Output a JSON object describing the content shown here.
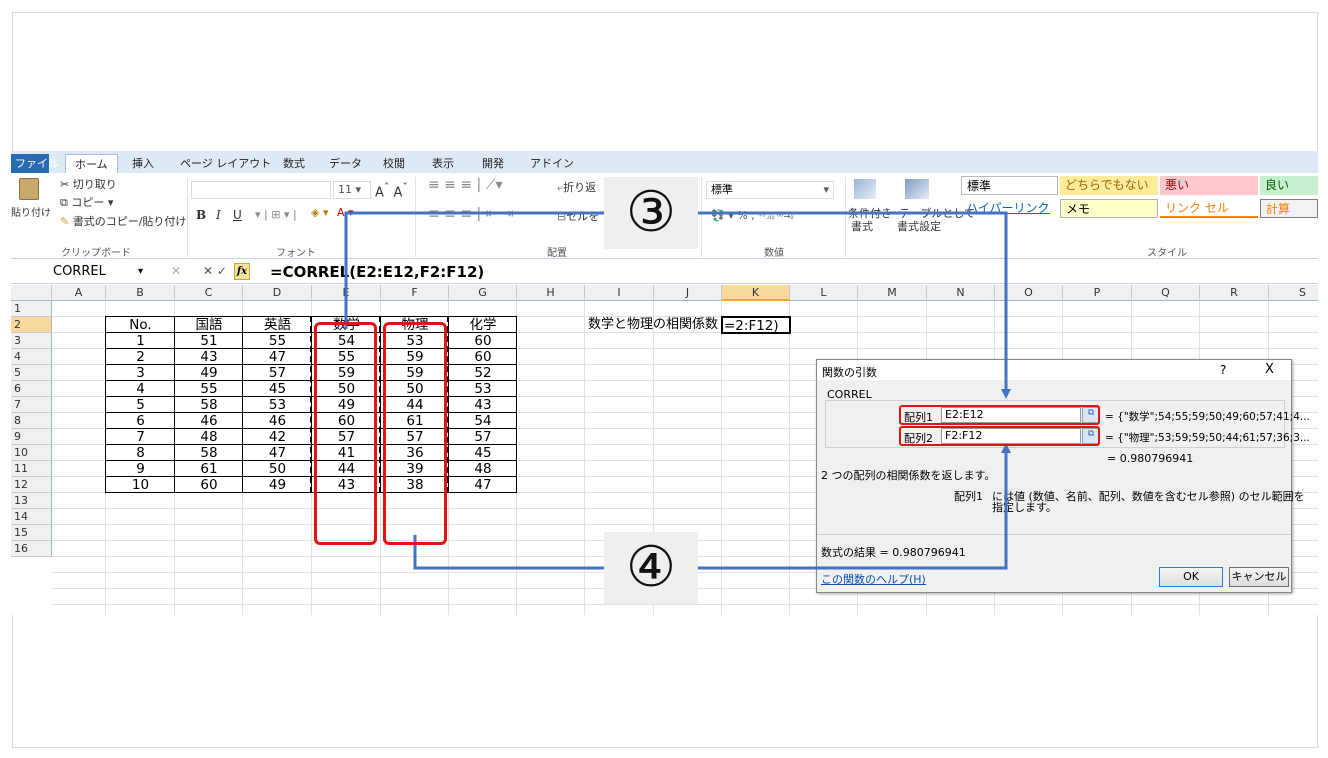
{
  "ribbon": {
    "tabs": [
      "ファイル",
      "ホーム",
      "挿入",
      "ページ レイアウト",
      "数式",
      "データ",
      "校閲",
      "表示",
      "開発",
      "アドイン"
    ],
    "clipboard": {
      "cut": "切り取り",
      "copy": "コピー",
      "format_painter": "書式のコピー/貼り付け",
      "paste": "貼り付け",
      "group": "クリップボード"
    },
    "font": {
      "size": "11",
      "group": "フォント"
    },
    "alignment": {
      "wrap": "折り返",
      "merge": "セルを",
      "group": "配置"
    },
    "number": {
      "format": "標準",
      "percent": "%",
      "comma": ",",
      "group": "数値"
    },
    "styles": {
      "cond_format": "条件付き",
      "cond_format2": "書式",
      "table_format": "テーブルとして",
      "table_format2": "書式設定",
      "normal": "標準",
      "neutral": "どちらでもない",
      "bad": "悪い",
      "good": "良い",
      "hyperlink": "ハイパーリンク",
      "memo": "メモ",
      "linked_cell": "リンク セル",
      "calc": "計算",
      "group": "スタイル"
    }
  },
  "formula_bar": {
    "name_box": "CORREL",
    "fx": "fx",
    "formula": "=CORREL(E2:E12,F2:F12)"
  },
  "sheet": {
    "columns": [
      "A",
      "B",
      "C",
      "D",
      "E",
      "F",
      "G",
      "H",
      "I",
      "J",
      "K",
      "L",
      "M",
      "N",
      "O",
      "P",
      "Q",
      "R",
      "S"
    ],
    "rows": [
      "1",
      "2",
      "3",
      "4",
      "5",
      "6",
      "7",
      "8",
      "9",
      "10",
      "11",
      "12",
      "13",
      "14",
      "15",
      "16"
    ],
    "headers": [
      "No.",
      "国語",
      "英語",
      "数学",
      "物理",
      "化学"
    ],
    "data": [
      [
        "1",
        "51",
        "55",
        "54",
        "53",
        "60"
      ],
      [
        "2",
        "43",
        "47",
        "55",
        "59",
        "60"
      ],
      [
        "3",
        "49",
        "57",
        "59",
        "59",
        "52"
      ],
      [
        "4",
        "55",
        "45",
        "50",
        "50",
        "53"
      ],
      [
        "5",
        "58",
        "53",
        "49",
        "44",
        "43"
      ],
      [
        "6",
        "46",
        "46",
        "60",
        "61",
        "54"
      ],
      [
        "7",
        "48",
        "42",
        "57",
        "57",
        "57"
      ],
      [
        "8",
        "58",
        "47",
        "41",
        "36",
        "45"
      ],
      [
        "9",
        "61",
        "50",
        "44",
        "39",
        "48"
      ],
      [
        "10",
        "60",
        "49",
        "43",
        "38",
        "47"
      ]
    ],
    "label_cell": "数学と物理の相関係数",
    "edit_cell": "=2:F12)"
  },
  "dialog": {
    "title": "関数の引数",
    "help_btn": "?",
    "close_btn": "X",
    "function_name": "CORREL",
    "arg1_label": "配列1",
    "arg1_value": "E2:E12",
    "arg1_result": "= {\"数学\";54;55;59;50;49;60;57;41;4...",
    "arg2_label": "配列2",
    "arg2_value": "F2:F12",
    "arg2_result": "= {\"物理\";53;59;59;50;44;61;57;36;3...",
    "result_preview": "= 0.980796941",
    "description": "2 つの配列の相関係数を返します。",
    "arg_desc_label": "配列1",
    "arg_desc_text": "には値 (数値、名前、配列、数値を含むセル参照) のセル範囲を",
    "arg_desc_text2": "指定します。",
    "formula_result": "数式の結果 = 0.980796941",
    "help_link": "この関数のヘルプ(H)",
    "ok": "OK",
    "cancel": "キャンセル"
  },
  "callouts": {
    "step3": "③",
    "step4": "④"
  },
  "colors": {
    "callout_line": "#4472c4",
    "highlight": "#e01414",
    "file_tab": "#2a6ab4"
  }
}
